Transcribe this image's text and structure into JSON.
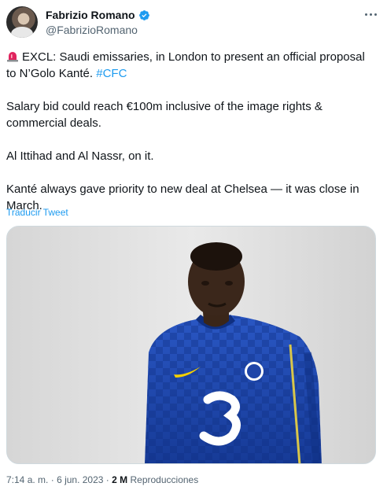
{
  "author": {
    "name": "Fabrizio Romano",
    "handle": "@FabrizioRomano"
  },
  "tweet": {
    "line1": "EXCL: Saudi emissaries, in London to present an official proposal to N’Golo Kanté.",
    "hashtag": "#CFC",
    "line2": "Salary bid could reach €100m inclusive of the image rights & commercial deals.",
    "line3": "Al Ittihad and Al Nassr, on it.",
    "line4": "Kanté always gave priority to new deal at Chelsea — it was close in March."
  },
  "translate_label": "Traducir Tweet",
  "meta": {
    "time": "7:14 a. m.",
    "separator1": "·",
    "date": "6 jun. 2023",
    "separator2": "·",
    "views": "2 M",
    "views_label": "Reproducciones"
  },
  "icons": {
    "siren": "police-siren-icon",
    "verified": "verified-badge-icon",
    "more": "more-options-icon"
  },
  "colors": {
    "accent": "#1d9bf0",
    "secondary_text": "#536471",
    "jersey": "#1f45a8"
  }
}
